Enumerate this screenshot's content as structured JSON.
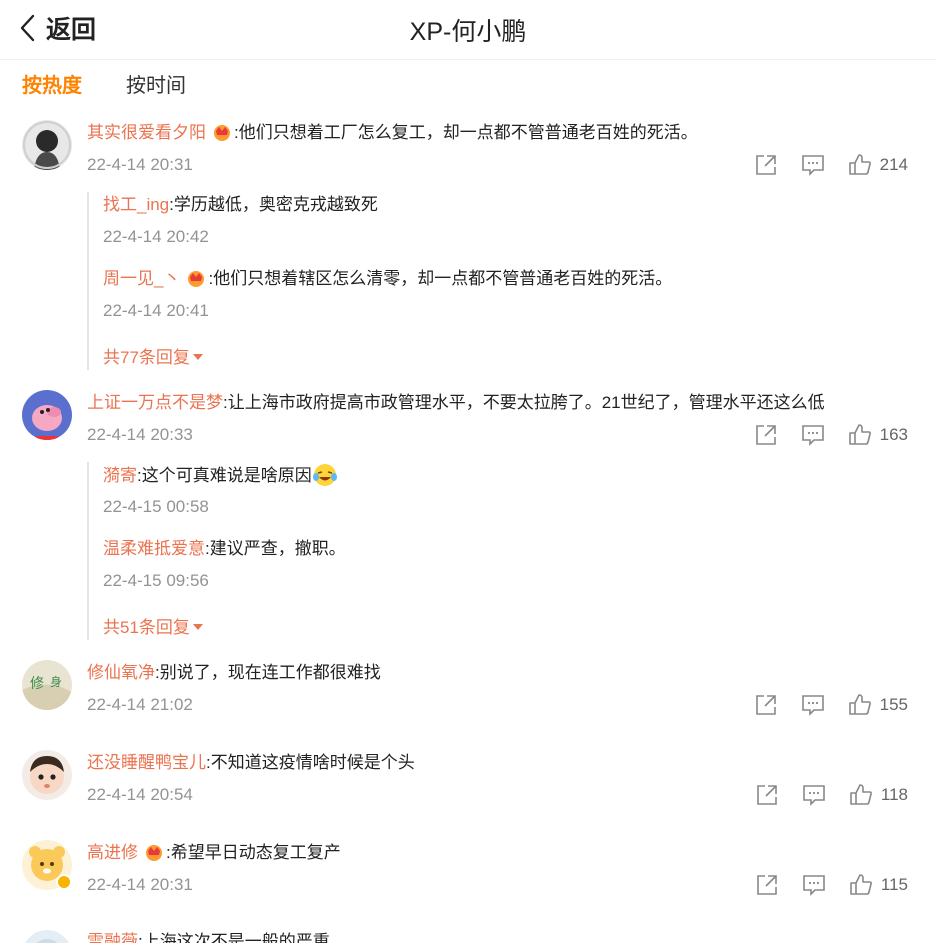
{
  "header": {
    "back_label": "返回",
    "title": "XP-何小鹏"
  },
  "sort_tabs": [
    {
      "label": "按热度",
      "active": true
    },
    {
      "label": "按时间",
      "active": false
    }
  ],
  "comments": [
    {
      "user": "其实很爱看夕阳",
      "has_badge": true,
      "text": ":他们只想着工厂怎么复工，却一点都不管普通老百姓的死活。",
      "time": "22-4-14 20:31",
      "likes": "214",
      "replies": [
        {
          "user": "找工_ing",
          "text": ":学历越低，奥密克戎越致死",
          "time": "22-4-14 20:42"
        },
        {
          "user": "周一见_丶",
          "has_badge": true,
          "text": ":他们只想着辖区怎么清零，却一点都不管普通老百姓的死活。",
          "time": "22-4-14 20:41"
        }
      ],
      "more_replies": "共77条回复"
    },
    {
      "user": "上证一万点不是梦",
      "text": ":让上海市政府提高市政管理水平，不要太拉胯了。21世纪了，管理水平还这么低",
      "time": "22-4-14 20:33",
      "likes": "163",
      "replies": [
        {
          "user": "漪寄",
          "text": ":这个可真难说是啥原因",
          "time": "22-4-15 00:58"
        },
        {
          "user": "温柔难抵爱意",
          "text": ":建议严查，撤职。",
          "time": "22-4-15 09:56"
        }
      ],
      "more_replies": "共51条回复"
    },
    {
      "user": "修仙氧净",
      "text": ":别说了，现在连工作都很难找",
      "time": "22-4-14 21:02",
      "likes": "155"
    },
    {
      "user": "还没睡醒鸭宝儿",
      "text": ":不知道这疫情啥时候是个头",
      "time": "22-4-14 20:54",
      "likes": "118"
    },
    {
      "user": "高进修",
      "has_badge": true,
      "text": ":希望早日动态复工复产",
      "time": "22-4-14 20:31",
      "likes": "115"
    },
    {
      "user": "雪融薇",
      "text": ":上海这次不是一般的严重"
    }
  ],
  "colors": {
    "accent": "#ff8200",
    "username": "#eb7350",
    "timestamp": "#939393"
  }
}
